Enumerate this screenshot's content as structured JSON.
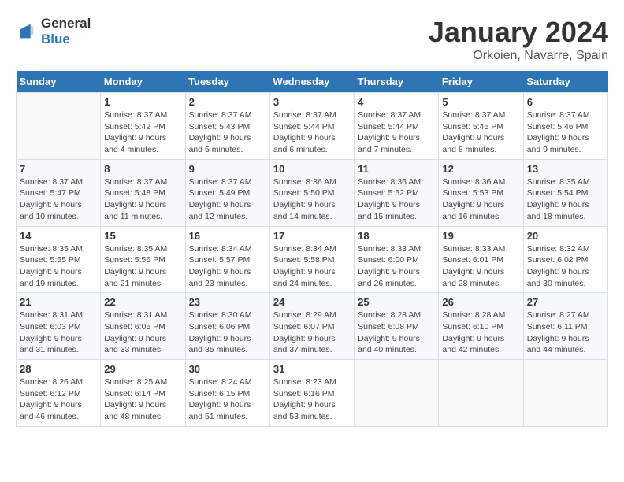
{
  "logo": {
    "text_general": "General",
    "text_blue": "Blue"
  },
  "calendar": {
    "title": "January 2024",
    "subtitle": "Orkoien, Navarre, Spain",
    "days_of_week": [
      "Sunday",
      "Monday",
      "Tuesday",
      "Wednesday",
      "Thursday",
      "Friday",
      "Saturday"
    ],
    "weeks": [
      [
        {
          "day": "",
          "sunrise": "",
          "sunset": "",
          "daylight": ""
        },
        {
          "day": "1",
          "sunrise": "Sunrise: 8:37 AM",
          "sunset": "Sunset: 5:42 PM",
          "daylight": "Daylight: 9 hours and 4 minutes."
        },
        {
          "day": "2",
          "sunrise": "Sunrise: 8:37 AM",
          "sunset": "Sunset: 5:43 PM",
          "daylight": "Daylight: 9 hours and 5 minutes."
        },
        {
          "day": "3",
          "sunrise": "Sunrise: 8:37 AM",
          "sunset": "Sunset: 5:44 PM",
          "daylight": "Daylight: 9 hours and 6 minutes."
        },
        {
          "day": "4",
          "sunrise": "Sunrise: 8:37 AM",
          "sunset": "Sunset: 5:44 PM",
          "daylight": "Daylight: 9 hours and 7 minutes."
        },
        {
          "day": "5",
          "sunrise": "Sunrise: 8:37 AM",
          "sunset": "Sunset: 5:45 PM",
          "daylight": "Daylight: 9 hours and 8 minutes."
        },
        {
          "day": "6",
          "sunrise": "Sunrise: 8:37 AM",
          "sunset": "Sunset: 5:46 PM",
          "daylight": "Daylight: 9 hours and 9 minutes."
        }
      ],
      [
        {
          "day": "7",
          "sunrise": "Sunrise: 8:37 AM",
          "sunset": "Sunset: 5:47 PM",
          "daylight": "Daylight: 9 hours and 10 minutes."
        },
        {
          "day": "8",
          "sunrise": "Sunrise: 8:37 AM",
          "sunset": "Sunset: 5:48 PM",
          "daylight": "Daylight: 9 hours and 11 minutes."
        },
        {
          "day": "9",
          "sunrise": "Sunrise: 8:37 AM",
          "sunset": "Sunset: 5:49 PM",
          "daylight": "Daylight: 9 hours and 12 minutes."
        },
        {
          "day": "10",
          "sunrise": "Sunrise: 8:36 AM",
          "sunset": "Sunset: 5:50 PM",
          "daylight": "Daylight: 9 hours and 14 minutes."
        },
        {
          "day": "11",
          "sunrise": "Sunrise: 8:36 AM",
          "sunset": "Sunset: 5:52 PM",
          "daylight": "Daylight: 9 hours and 15 minutes."
        },
        {
          "day": "12",
          "sunrise": "Sunrise: 8:36 AM",
          "sunset": "Sunset: 5:53 PM",
          "daylight": "Daylight: 9 hours and 16 minutes."
        },
        {
          "day": "13",
          "sunrise": "Sunrise: 8:35 AM",
          "sunset": "Sunset: 5:54 PM",
          "daylight": "Daylight: 9 hours and 18 minutes."
        }
      ],
      [
        {
          "day": "14",
          "sunrise": "Sunrise: 8:35 AM",
          "sunset": "Sunset: 5:55 PM",
          "daylight": "Daylight: 9 hours and 19 minutes."
        },
        {
          "day": "15",
          "sunrise": "Sunrise: 8:35 AM",
          "sunset": "Sunset: 5:56 PM",
          "daylight": "Daylight: 9 hours and 21 minutes."
        },
        {
          "day": "16",
          "sunrise": "Sunrise: 8:34 AM",
          "sunset": "Sunset: 5:57 PM",
          "daylight": "Daylight: 9 hours and 23 minutes."
        },
        {
          "day": "17",
          "sunrise": "Sunrise: 8:34 AM",
          "sunset": "Sunset: 5:58 PM",
          "daylight": "Daylight: 9 hours and 24 minutes."
        },
        {
          "day": "18",
          "sunrise": "Sunrise: 8:33 AM",
          "sunset": "Sunset: 6:00 PM",
          "daylight": "Daylight: 9 hours and 26 minutes."
        },
        {
          "day": "19",
          "sunrise": "Sunrise: 8:33 AM",
          "sunset": "Sunset: 6:01 PM",
          "daylight": "Daylight: 9 hours and 28 minutes."
        },
        {
          "day": "20",
          "sunrise": "Sunrise: 8:32 AM",
          "sunset": "Sunset: 6:02 PM",
          "daylight": "Daylight: 9 hours and 30 minutes."
        }
      ],
      [
        {
          "day": "21",
          "sunrise": "Sunrise: 8:31 AM",
          "sunset": "Sunset: 6:03 PM",
          "daylight": "Daylight: 9 hours and 31 minutes."
        },
        {
          "day": "22",
          "sunrise": "Sunrise: 8:31 AM",
          "sunset": "Sunset: 6:05 PM",
          "daylight": "Daylight: 9 hours and 33 minutes."
        },
        {
          "day": "23",
          "sunrise": "Sunrise: 8:30 AM",
          "sunset": "Sunset: 6:06 PM",
          "daylight": "Daylight: 9 hours and 35 minutes."
        },
        {
          "day": "24",
          "sunrise": "Sunrise: 8:29 AM",
          "sunset": "Sunset: 6:07 PM",
          "daylight": "Daylight: 9 hours and 37 minutes."
        },
        {
          "day": "25",
          "sunrise": "Sunrise: 8:28 AM",
          "sunset": "Sunset: 6:08 PM",
          "daylight": "Daylight: 9 hours and 40 minutes."
        },
        {
          "day": "26",
          "sunrise": "Sunrise: 8:28 AM",
          "sunset": "Sunset: 6:10 PM",
          "daylight": "Daylight: 9 hours and 42 minutes."
        },
        {
          "day": "27",
          "sunrise": "Sunrise: 8:27 AM",
          "sunset": "Sunset: 6:11 PM",
          "daylight": "Daylight: 9 hours and 44 minutes."
        }
      ],
      [
        {
          "day": "28",
          "sunrise": "Sunrise: 8:26 AM",
          "sunset": "Sunset: 6:12 PM",
          "daylight": "Daylight: 9 hours and 46 minutes."
        },
        {
          "day": "29",
          "sunrise": "Sunrise: 8:25 AM",
          "sunset": "Sunset: 6:14 PM",
          "daylight": "Daylight: 9 hours and 48 minutes."
        },
        {
          "day": "30",
          "sunrise": "Sunrise: 8:24 AM",
          "sunset": "Sunset: 6:15 PM",
          "daylight": "Daylight: 9 hours and 51 minutes."
        },
        {
          "day": "31",
          "sunrise": "Sunrise: 8:23 AM",
          "sunset": "Sunset: 6:16 PM",
          "daylight": "Daylight: 9 hours and 53 minutes."
        },
        {
          "day": "",
          "sunrise": "",
          "sunset": "",
          "daylight": ""
        },
        {
          "day": "",
          "sunrise": "",
          "sunset": "",
          "daylight": ""
        },
        {
          "day": "",
          "sunrise": "",
          "sunset": "",
          "daylight": ""
        }
      ]
    ]
  }
}
